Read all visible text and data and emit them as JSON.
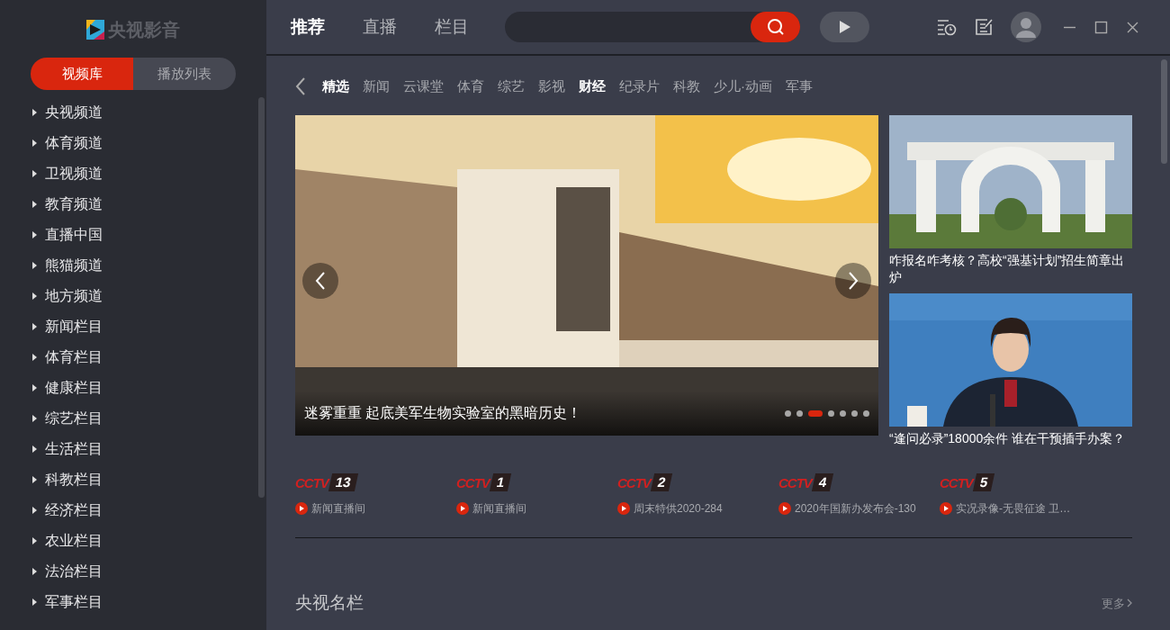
{
  "app": {
    "logo_text": "央视影音"
  },
  "sidebar_tabs": [
    {
      "label": "视频库",
      "selected": true
    },
    {
      "label": "播放列表",
      "selected": false
    }
  ],
  "sidebar": {
    "items": [
      {
        "label": "央视频道"
      },
      {
        "label": "体育频道"
      },
      {
        "label": "卫视频道"
      },
      {
        "label": "教育频道"
      },
      {
        "label": "直播中国"
      },
      {
        "label": "熊猫频道"
      },
      {
        "label": "地方频道"
      },
      {
        "label": "新闻栏目"
      },
      {
        "label": "体育栏目"
      },
      {
        "label": "健康栏目"
      },
      {
        "label": "综艺栏目"
      },
      {
        "label": "生活栏目"
      },
      {
        "label": "科教栏目"
      },
      {
        "label": "经济栏目"
      },
      {
        "label": "农业栏目"
      },
      {
        "label": "法治栏目"
      },
      {
        "label": "军事栏目"
      }
    ]
  },
  "nav_tabs": [
    {
      "label": "推荐",
      "selected": true
    },
    {
      "label": "直播",
      "selected": false
    },
    {
      "label": "栏目",
      "selected": false
    }
  ],
  "categories": [
    {
      "label": "精选",
      "selected": true
    },
    {
      "label": "新闻",
      "selected": false
    },
    {
      "label": "云课堂",
      "selected": false
    },
    {
      "label": "体育",
      "selected": false
    },
    {
      "label": "综艺",
      "selected": false
    },
    {
      "label": "影视",
      "selected": false
    },
    {
      "label": "财经",
      "selected": true
    },
    {
      "label": "纪录片",
      "selected": false
    },
    {
      "label": "科教",
      "selected": false
    },
    {
      "label": "少儿·动画",
      "selected": false
    },
    {
      "label": "军事",
      "selected": false
    }
  ],
  "banner": {
    "caption": "迷雾重重 起底美军生物实验室的黑暗历史！",
    "dots": [
      {
        "selected": false
      },
      {
        "selected": false
      },
      {
        "selected": true
      },
      {
        "selected": false
      },
      {
        "selected": false
      },
      {
        "selected": false
      },
      {
        "selected": false
      }
    ]
  },
  "side_cards": [
    {
      "title": "咋报名咋考核？高校“强基计划”招生简章出炉"
    },
    {
      "title": "“逢问必录”18000余件 谁在干预插手办案？"
    }
  ],
  "channels": [
    {
      "logo": "CCTV",
      "number": "13",
      "program": "新闻直播间"
    },
    {
      "logo": "CCTV",
      "number": "1",
      "program": "新闻直播间"
    },
    {
      "logo": "CCTV",
      "number": "2",
      "program": "周末特供2020-284"
    },
    {
      "logo": "CCTV",
      "number": "4",
      "program": "2020年国新办发布会-130"
    },
    {
      "logo": "CCTV",
      "number": "5",
      "program": "实况录像-无畏征途 卫…"
    }
  ],
  "section": {
    "title": "央视名栏",
    "more": "更多"
  }
}
